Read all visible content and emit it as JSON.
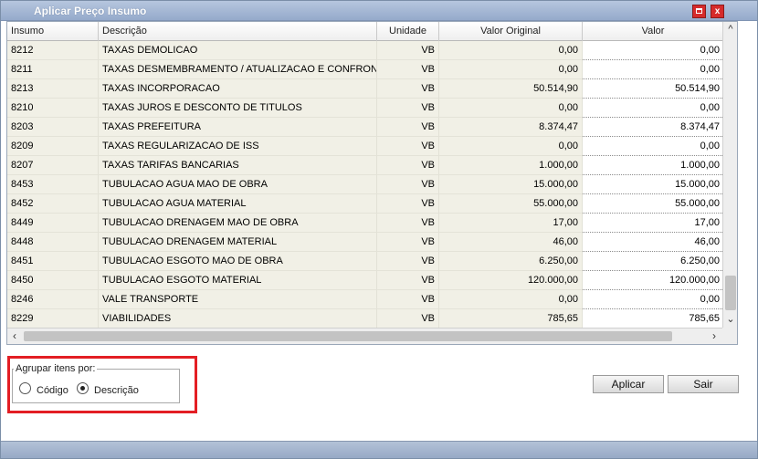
{
  "window": {
    "title": "Aplicar Preço Insumo"
  },
  "table": {
    "headers": [
      "Insumo",
      "Descrição",
      "Unidade",
      "Valor Original",
      "Valor"
    ],
    "rows": [
      [
        "8212",
        "TAXAS DEMOLICAO",
        "VB",
        "0,00",
        "0,00"
      ],
      [
        "8211",
        "TAXAS DESMEMBRAMENTO / ATUALIZACAO E CONFRONTAC",
        "VB",
        "0,00",
        "0,00"
      ],
      [
        "8213",
        "TAXAS INCORPORACAO",
        "VB",
        "50.514,90",
        "50.514,90"
      ],
      [
        "8210",
        "TAXAS JUROS E DESCONTO DE TITULOS",
        "VB",
        "0,00",
        "0,00"
      ],
      [
        "8203",
        "TAXAS PREFEITURA",
        "VB",
        "8.374,47",
        "8.374,47"
      ],
      [
        "8209",
        "TAXAS REGULARIZACAO DE ISS",
        "VB",
        "0,00",
        "0,00"
      ],
      [
        "8207",
        "TAXAS TARIFAS BANCARIAS",
        "VB",
        "1.000,00",
        "1.000,00"
      ],
      [
        "8453",
        "TUBULACAO AGUA MAO DE OBRA",
        "VB",
        "15.000,00",
        "15.000,00"
      ],
      [
        "8452",
        "TUBULACAO AGUA MATERIAL",
        "VB",
        "55.000,00",
        "55.000,00"
      ],
      [
        "8449",
        "TUBULACAO DRENAGEM MAO DE OBRA",
        "VB",
        "17,00",
        "17,00"
      ],
      [
        "8448",
        "TUBULACAO DRENAGEM MATERIAL",
        "VB",
        "46,00",
        "46,00"
      ],
      [
        "8451",
        "TUBULACAO ESGOTO MAO DE OBRA",
        "VB",
        "6.250,00",
        "6.250,00"
      ],
      [
        "8450",
        "TUBULACAO ESGOTO MATERIAL",
        "VB",
        "120.000,00",
        "120.000,00"
      ],
      [
        "8246",
        "VALE TRANSPORTE",
        "VB",
        "0,00",
        "0,00"
      ],
      [
        "8229",
        "VIABILIDADES",
        "VB",
        "785,65",
        "785,65"
      ]
    ]
  },
  "group": {
    "legend": "Agrupar itens por:",
    "options": [
      {
        "label": "Código",
        "checked": false
      },
      {
        "label": "Descrição",
        "checked": true
      }
    ]
  },
  "buttons": {
    "apply": "Aplicar",
    "exit": "Sair"
  },
  "icons": {
    "maximize": "maximize-icon",
    "close": "close-icon",
    "close_glyph": "x"
  },
  "colors": {
    "title_bar": "#95aacb",
    "close_button": "#d62b2b",
    "highlight": "#e31e24",
    "grid_bg": "#f1f0e6"
  }
}
